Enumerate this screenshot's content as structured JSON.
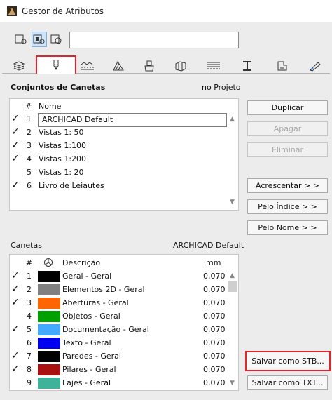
{
  "window": {
    "title": "Gestor de Atributos"
  },
  "search": {
    "value": ""
  },
  "view_buttons": [
    "view-1-icon",
    "view-2-icon",
    "view-3-icon"
  ],
  "tabs": [
    "layers-icon",
    "pen-icon",
    "line-icon",
    "fill-icon",
    "surface-icon",
    "composite-icon",
    "profile-icon",
    "column-icon",
    "zone-icon",
    "material-icon"
  ],
  "pensets": {
    "title": "Conjuntos de Canetas",
    "scope": "no Projeto",
    "col_hash": "#",
    "col_name": "Nome",
    "rows": [
      {
        "check": "✓",
        "num": "1",
        "name": "ARCHICAD Default"
      },
      {
        "check": "✓",
        "num": "2",
        "name": "Vistas 1: 50"
      },
      {
        "check": "✓",
        "num": "3",
        "name": "Vistas 1:100"
      },
      {
        "check": "✓",
        "num": "4",
        "name": "Vistas 1:200"
      },
      {
        "check": "",
        "num": "5",
        "name": "Vistas 1: 20"
      },
      {
        "check": "✓",
        "num": "6",
        "name": "Livro de Leiautes"
      }
    ]
  },
  "buttons": {
    "duplicar": "Duplicar",
    "apagar": "Apagar",
    "eliminar": "Eliminar",
    "acrescentar": "Acrescentar > >",
    "pelo_indice": "Pelo Índice > >",
    "pelo_nome": "Pelo Nome > >",
    "salvar_stb": "Salvar como STB...",
    "salvar_txt": "Salvar como TXT..."
  },
  "pens": {
    "title": "Canetas",
    "set_name": "ARCHICAD Default",
    "col_hash": "#",
    "col_desc": "Descrição",
    "col_mm": "mm",
    "rows": [
      {
        "check": "✓",
        "num": "1",
        "color": "#000000",
        "desc": "Geral - Geral",
        "mm": "0,070"
      },
      {
        "check": "✓",
        "num": "2",
        "color": "#808080",
        "desc": "Elementos 2D - Geral",
        "mm": "0,070"
      },
      {
        "check": "✓",
        "num": "3",
        "color": "#ff6600",
        "desc": "Aberturas - Geral",
        "mm": "0,070"
      },
      {
        "check": "",
        "num": "4",
        "color": "#00a000",
        "desc": "Objetos - Geral",
        "mm": "0,070"
      },
      {
        "check": "✓",
        "num": "5",
        "color": "#44aaff",
        "desc": "Documentação - Geral",
        "mm": "0,070"
      },
      {
        "check": "",
        "num": "6",
        "color": "#0000ee",
        "desc": "Texto - Geral",
        "mm": "0,070"
      },
      {
        "check": "✓",
        "num": "7",
        "color": "#000000",
        "desc": "Paredes - Geral",
        "mm": "0,070"
      },
      {
        "check": "✓",
        "num": "8",
        "color": "#aa1111",
        "desc": "Pilares - Geral",
        "mm": "0,070"
      },
      {
        "check": "",
        "num": "9",
        "color": "#3fb39a",
        "desc": "Lajes - Geral",
        "mm": "0,070"
      }
    ]
  },
  "colors": {
    "highlight": "#e2242c",
    "selection_bg": "#cfe4f8"
  }
}
